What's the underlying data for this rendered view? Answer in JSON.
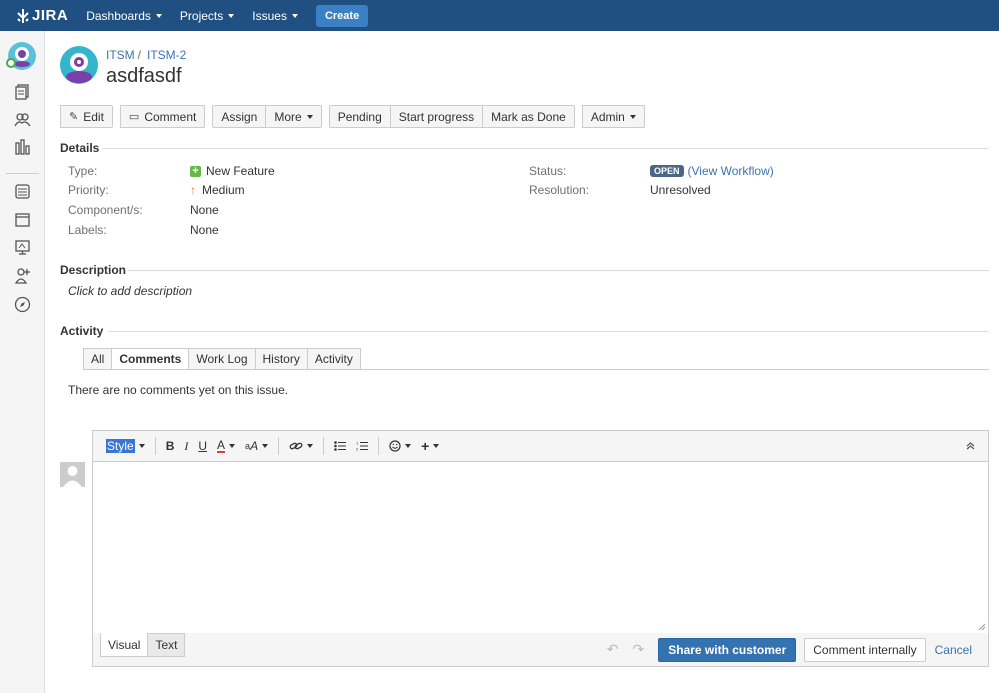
{
  "topnav": {
    "logo_text": "JIRA",
    "menus": [
      "Dashboards",
      "Projects",
      "Issues"
    ],
    "create_label": "Create"
  },
  "issue": {
    "project": "ITSM",
    "key": "ITSM-2",
    "title": "asdfasdf"
  },
  "toolbar": {
    "edit": "Edit",
    "comment": "Comment",
    "assign": "Assign",
    "more": "More",
    "pending": "Pending",
    "start_progress": "Start progress",
    "mark_done": "Mark as Done",
    "admin": "Admin"
  },
  "details": {
    "heading": "Details",
    "type_label": "Type:",
    "type_value": "New Feature",
    "priority_label": "Priority:",
    "priority_value": "Medium",
    "components_label": "Component/s:",
    "components_value": "None",
    "labels_label": "Labels:",
    "labels_value": "None",
    "status_label": "Status:",
    "status_value": "OPEN",
    "view_workflow": "(View Workflow)",
    "resolution_label": "Resolution:",
    "resolution_value": "Unresolved"
  },
  "description": {
    "heading": "Description",
    "placeholder": "Click to add description"
  },
  "activity": {
    "heading": "Activity",
    "tabs": [
      "All",
      "Comments",
      "Work Log",
      "History",
      "Activity"
    ],
    "active_tab": "Comments",
    "empty_message": "There are no comments yet on this issue."
  },
  "editor": {
    "style_label": "Style",
    "mode_tabs": [
      "Visual",
      "Text"
    ],
    "share_button": "Share with customer",
    "internal_button": "Comment internally",
    "cancel": "Cancel"
  },
  "colors": {
    "nav_bg": "#205081",
    "primary": "#3572b0",
    "link": "#3b73af",
    "status_lozenge": "#4a6785"
  }
}
